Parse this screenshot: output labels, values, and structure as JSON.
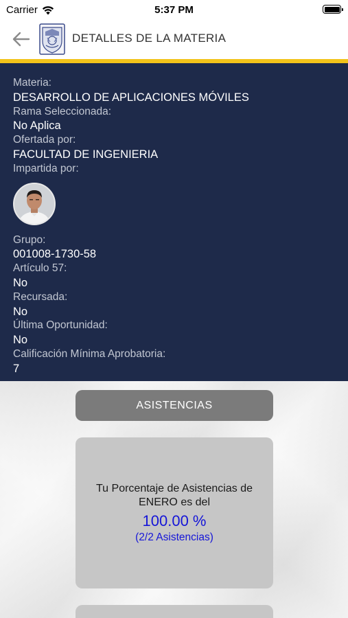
{
  "status_bar": {
    "carrier": "Carrier",
    "time": "5:37 PM"
  },
  "nav": {
    "title": "DETALLES DE LA MATERIA"
  },
  "details": {
    "materia_label": "Materia:",
    "materia_value": "DESARROLLO DE APLICACIONES MÓVILES",
    "rama_label": "Rama Seleccionada:",
    "rama_value": "No Aplica",
    "ofertada_label": "Ofertada por:",
    "ofertada_value": "FACULTAD DE INGENIERIA",
    "impartida_label": "Impartida por:",
    "grupo_label": "Grupo:",
    "grupo_value": "001008-1730-58",
    "articulo_label": "Artículo 57:",
    "articulo_value": "No",
    "recursada_label": "Recursada:",
    "recursada_value": "No",
    "ultima_label": "Última Oportunidad:",
    "ultima_value": "No",
    "calificacion_label": "Calificación Mínima Aprobatoria:",
    "calificacion_value": "7"
  },
  "asistencias": {
    "button_label": "ASISTENCIAS",
    "card_text": "Tu Porcentaje de Asistencias de ENERO es del",
    "percent": "100.00 %",
    "count": "(2/2 Asistencias)"
  },
  "colors": {
    "panel_bg": "#1e2a4a",
    "accent_gold": "#f2c31a",
    "percent_blue": "#1515d8",
    "button_gray": "#7b7b7b",
    "card_gray": "#c6c6c6"
  },
  "icons": [
    "wifi-icon",
    "battery-icon",
    "back-arrow-icon",
    "university-crest-logo",
    "teacher-avatar"
  ]
}
